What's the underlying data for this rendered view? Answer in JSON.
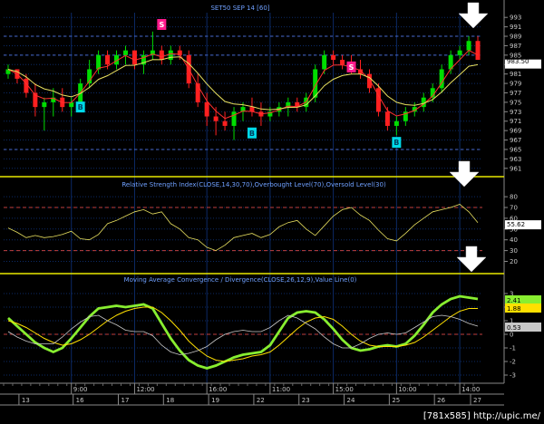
{
  "chart_data": [
    {
      "type": "candlestick",
      "title": "SET50 SEP 14   [60]",
      "y_axis_ticks": [
        961,
        963,
        965,
        967,
        969,
        971,
        973,
        975,
        977,
        979,
        981,
        983,
        985,
        987,
        989,
        991,
        993
      ],
      "ylim": [
        960,
        994
      ],
      "last_value_label": "983.50",
      "reference_levels": [
        965,
        985,
        989
      ],
      "candles": [
        [
          981,
          983,
          980,
          982
        ],
        [
          982,
          982,
          979,
          980
        ],
        [
          980,
          981,
          976,
          977
        ],
        [
          977,
          979,
          972,
          974
        ],
        [
          974,
          976,
          969,
          975
        ],
        [
          975,
          978,
          972,
          976
        ],
        [
          976,
          978,
          973,
          974
        ],
        [
          974,
          976,
          972,
          975
        ],
        [
          975,
          980,
          974,
          979
        ],
        [
          979,
          984,
          978,
          982
        ],
        [
          982,
          986,
          981,
          985
        ],
        [
          985,
          986,
          982,
          983
        ],
        [
          983,
          986,
          982,
          985
        ],
        [
          985,
          987,
          983,
          986
        ],
        [
          986,
          986,
          982,
          983
        ],
        [
          983,
          986,
          981,
          985
        ],
        [
          985,
          990,
          984,
          986
        ],
        [
          986,
          987,
          983,
          984
        ],
        [
          984,
          987,
          983,
          986
        ],
        [
          986,
          987,
          984,
          985
        ],
        [
          985,
          986,
          978,
          979
        ],
        [
          979,
          981,
          974,
          975
        ],
        [
          975,
          977,
          970,
          972
        ],
        [
          972,
          974,
          968,
          971
        ],
        [
          971,
          973,
          969,
          970
        ],
        [
          970,
          974,
          967,
          973
        ],
        [
          973,
          975,
          971,
          974
        ],
        [
          974,
          976,
          972,
          973
        ],
        [
          973,
          975,
          970,
          972
        ],
        [
          972,
          974,
          971,
          973
        ],
        [
          973,
          975,
          972,
          974
        ],
        [
          974,
          976,
          972,
          975
        ],
        [
          975,
          976,
          973,
          974
        ],
        [
          974,
          977,
          973,
          976
        ],
        [
          976,
          983,
          975,
          982
        ],
        [
          982,
          986,
          981,
          985
        ],
        [
          985,
          986,
          983,
          984
        ],
        [
          984,
          985,
          982,
          983
        ],
        [
          983,
          985,
          981,
          982
        ],
        [
          982,
          984,
          980,
          981
        ],
        [
          981,
          982,
          977,
          978
        ],
        [
          978,
          979,
          972,
          973
        ],
        [
          973,
          974,
          969,
          970
        ],
        [
          970,
          972,
          968,
          971
        ],
        [
          971,
          974,
          970,
          973
        ],
        [
          973,
          975,
          972,
          974
        ],
        [
          974,
          977,
          973,
          976
        ],
        [
          976,
          979,
          975,
          978
        ],
        [
          978,
          983,
          977,
          982
        ],
        [
          982,
          986,
          981,
          985
        ],
        [
          985,
          987,
          984,
          986
        ],
        [
          986,
          989,
          985,
          988
        ],
        [
          988,
          989,
          984,
          984
        ]
      ],
      "moving_averages": [
        {
          "name": "",
          "color": "#ff3030"
        },
        {
          "name": "",
          "color": "#e8e060"
        }
      ],
      "signals": [
        {
          "label": "B",
          "index": 8,
          "price": 974,
          "color": "#00d8e8"
        },
        {
          "label": "S",
          "index": 17,
          "price": 991.5,
          "color": "#ff1a8c"
        },
        {
          "label": "B",
          "index": 27,
          "price": 968.5,
          "color": "#00d8e8"
        },
        {
          "label": "S",
          "index": 38,
          "price": 982.5,
          "color": "#ff1a8c"
        },
        {
          "label": "B",
          "index": 43,
          "price": 966.5,
          "color": "#00d8e8"
        }
      ]
    },
    {
      "type": "line",
      "title": "Relative Strength Index(CLOSE,14,30,70),Overbought Level(70),Oversold Level(30)",
      "y_axis_ticks": [
        20,
        30,
        40,
        50,
        60,
        70,
        80
      ],
      "ylim": [
        12,
        86
      ],
      "last_value_label": "55.62",
      "levels": [
        70,
        30
      ],
      "series": [
        {
          "name": "",
          "color": "#e8e060",
          "values": [
            51,
            47,
            42,
            44,
            42,
            43,
            45,
            48,
            41,
            40,
            45,
            55,
            58,
            62,
            66,
            68,
            64,
            66,
            55,
            50,
            42,
            40,
            33,
            30,
            35,
            42,
            44,
            46,
            42,
            45,
            52,
            56,
            58,
            50,
            44,
            53,
            62,
            68,
            70,
            63,
            58,
            49,
            41,
            39,
            46,
            54,
            60,
            66,
            68,
            70,
            73,
            66,
            56
          ]
        }
      ]
    },
    {
      "type": "line",
      "title": "Moving Average Convergence / Divergence(CLOSE,26,12,9),Value Line(0)",
      "y_axis_ticks": [
        -3,
        -2,
        -1,
        0,
        1,
        2,
        3
      ],
      "ylim": [
        -3.6,
        3.6
      ],
      "last_value_labels": [
        "2.41",
        "1.88",
        "0.53"
      ],
      "levels": [
        0
      ],
      "series": [
        {
          "name": "",
          "color": "#88ee30",
          "values": [
            1.2,
            0.6,
            0,
            -0.6,
            -1,
            -1.3,
            -1,
            -0.3,
            0.5,
            1.3,
            1.9,
            2,
            2.1,
            2,
            2.1,
            2.2,
            1.9,
            0.8,
            -0.3,
            -1.2,
            -1.9,
            -2.3,
            -2.5,
            -2.3,
            -2,
            -1.7,
            -1.5,
            -1.4,
            -1.3,
            -0.8,
            0.2,
            1.2,
            1.6,
            1.7,
            1.6,
            1.1,
            0.4,
            -0.4,
            -1,
            -1.2,
            -1.1,
            -0.9,
            -0.8,
            -0.9,
            -0.7,
            -0.1,
            0.7,
            1.6,
            2.2,
            2.6,
            2.8,
            2.7,
            2.6
          ]
        },
        {
          "name": "",
          "color": "#ffe000",
          "values": [
            1.0,
            0.8,
            0.5,
            0.1,
            -0.3,
            -0.6,
            -0.8,
            -0.7,
            -0.4,
            0,
            0.5,
            1,
            1.4,
            1.7,
            1.9,
            2,
            2,
            1.6,
            1,
            0.3,
            -0.5,
            -1.1,
            -1.6,
            -1.9,
            -2,
            -1.9,
            -1.8,
            -1.6,
            -1.5,
            -1.3,
            -0.8,
            -0.2,
            0.4,
            0.9,
            1.2,
            1.3,
            1.1,
            0.6,
            0,
            -0.5,
            -0.8,
            -0.9,
            -0.9,
            -0.9,
            -0.8,
            -0.6,
            -0.2,
            0.3,
            0.8,
            1.3,
            1.7,
            1.9,
            1.9
          ]
        },
        {
          "name": "",
          "color": "#c8c8c8",
          "values": [
            0.2,
            -0.2,
            -0.5,
            -0.7,
            -0.7,
            -0.7,
            -0.2,
            0.4,
            0.9,
            1.3,
            1.4,
            1,
            0.7,
            0.3,
            0.2,
            0.2,
            -0.1,
            -0.8,
            -1.3,
            -1.5,
            -1.4,
            -1.2,
            -0.9,
            -0.4,
            0,
            0.2,
            0.3,
            0.2,
            0.2,
            0.5,
            1,
            1.4,
            1.2,
            0.8,
            0.4,
            -0.2,
            -0.7,
            -1,
            -1,
            -0.7,
            -0.3,
            0,
            0.1,
            0,
            0.1,
            0.5,
            0.9,
            1.3,
            1.4,
            1.3,
            1.1,
            0.8,
            0.6
          ]
        }
      ]
    }
  ],
  "x_axis": {
    "time_labels": [
      {
        "text": "9:00",
        "index": 7
      },
      {
        "text": "12:00",
        "index": 14
      },
      {
        "text": "16:00",
        "index": 22
      },
      {
        "text": "11:00",
        "index": 29
      },
      {
        "text": "15:00",
        "index": 36
      },
      {
        "text": "10:00",
        "index": 43
      },
      {
        "text": "14:00",
        "index": 50
      }
    ],
    "date_labels": [
      {
        "text": "13",
        "index": 2
      },
      {
        "text": "16",
        "index": 8
      },
      {
        "text": "17",
        "index": 13
      },
      {
        "text": "18",
        "index": 18
      },
      {
        "text": "19",
        "index": 23
      },
      {
        "text": "22",
        "index": 28
      },
      {
        "text": "23",
        "index": 33
      },
      {
        "text": "24",
        "index": 38
      },
      {
        "text": "25",
        "index": 43
      },
      {
        "text": "26",
        "index": 48
      },
      {
        "text": "27",
        "index": 52
      }
    ]
  },
  "watermark": "[781x585] http://upic.me/",
  "colors": {
    "bull": "#00dd00",
    "bear": "#ff2020",
    "grid": "#0c2a66",
    "divider": "#e8e800",
    "axis_text": "#c8c8c8",
    "title_text": "#6fa0ff"
  }
}
